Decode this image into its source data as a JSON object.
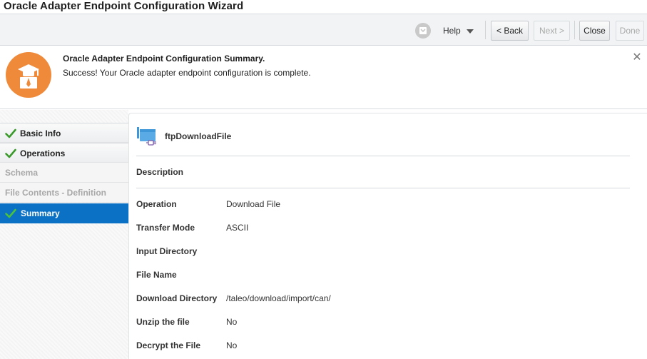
{
  "window": {
    "title": "Oracle Adapter Endpoint Configuration Wizard"
  },
  "toolbar": {
    "help_label": "Help",
    "back_label": "< Back",
    "next_label": "Next >",
    "close_label": "Close",
    "done_label": "Done"
  },
  "banner": {
    "title": "Oracle Adapter Endpoint Configuration Summary.",
    "message": "Success! Your Oracle adapter endpoint configuration is complete.",
    "icon": "graduate-icon",
    "close_icon": "close-icon",
    "accent_color": "#f08a3b"
  },
  "nav": {
    "items": [
      {
        "label": "Basic Info",
        "state": "done"
      },
      {
        "label": "Operations",
        "state": "done"
      },
      {
        "label": "Schema",
        "state": "pending"
      },
      {
        "label": "File Contents - Definition",
        "state": "pending"
      },
      {
        "label": "Summary",
        "state": "active"
      }
    ],
    "active_color": "#0a71c5",
    "check_color": "#3a9a2b"
  },
  "summary": {
    "endpoint_name": "ftpDownloadFile",
    "description_label": "Description",
    "rows": [
      {
        "key": "Operation",
        "value": "Download File"
      },
      {
        "key": "Transfer Mode",
        "value": "ASCII"
      },
      {
        "key": "Input Directory",
        "value": ""
      },
      {
        "key": "File Name",
        "value": ""
      },
      {
        "key": "Download Directory",
        "value": "/taleo/download/import/can/"
      },
      {
        "key": "Unzip the file",
        "value": "No"
      },
      {
        "key": "Decrypt the File",
        "value": "No"
      }
    ]
  }
}
